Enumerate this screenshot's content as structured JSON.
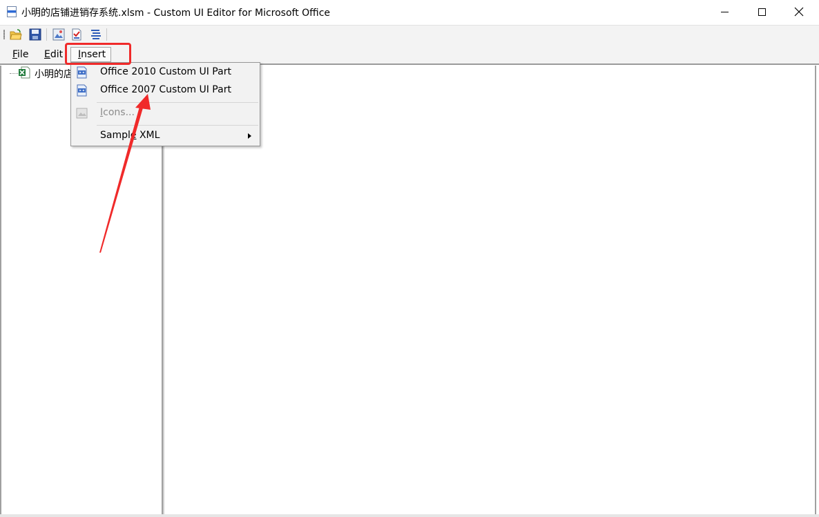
{
  "window": {
    "title": "小明的店铺进销存系统.xlsm - Custom UI Editor for Microsoft Office"
  },
  "toolbar": {
    "buttons": [
      "open-icon",
      "save-icon",
      "insert-icons-icon",
      "validate-icon",
      "format-xml-icon"
    ]
  },
  "menubar": {
    "file": {
      "key": "F",
      "rest": "ile"
    },
    "edit": {
      "key": "E",
      "rest": "dit"
    },
    "insert": {
      "key": "I",
      "rest": "nsert"
    }
  },
  "tree": {
    "root_label": "小明的店"
  },
  "insert_menu": {
    "office2010": "Office 2010 Custom UI Part",
    "office2007": "Office 2007 Custom UI Part",
    "icons": {
      "key": "I",
      "rest": "cons..."
    },
    "sample_xml": {
      "pre": "Sampl",
      "key": "e",
      "rest": " XML"
    }
  },
  "colors": {
    "annotation": "#f02a2a",
    "menu_bg": "#f2f2f2"
  }
}
